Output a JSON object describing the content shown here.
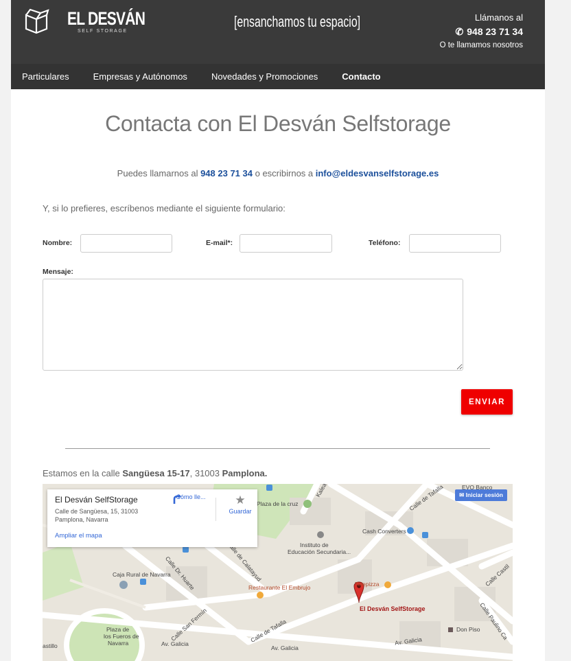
{
  "header": {
    "brand": "EL DESVÁN",
    "brand_sub": "SELF STORAGE",
    "slogan": "[ensanchamos tu espacio]",
    "call_label": "Llámanos al",
    "phone": "948 23 71 34",
    "callback": "O te llamamos nosotros"
  },
  "nav": {
    "items": [
      "Particulares",
      "Empresas y Autónomos",
      "Novedades y Promociones",
      "Contacto"
    ]
  },
  "main": {
    "title": "Contacta con El Desván Selfstorage",
    "contact_pre": "Puedes llamarnos al ",
    "contact_phone": "948 23 71 34",
    "contact_mid": " o escribirnos a ",
    "contact_email": "info@eldesvanselfstorage.es",
    "intro": "Y, si lo prefieres, escríbenos mediante el siguiente formulario:"
  },
  "form": {
    "name_label": "Nombre:",
    "email_label": "E-mail*:",
    "phone_label": "Teléfono:",
    "message_label": "Mensaje:",
    "submit": "ENVIAR"
  },
  "location": {
    "pre": "Estamos en la calle ",
    "street": "Sangüesa 15-17",
    "mid": ", 31003 ",
    "city": "Pamplona."
  },
  "map": {
    "card_title": "El Desván SelfStorage",
    "card_address_1": "Calle de Sangüesa, 15, 31003",
    "card_address_2": "Pamplona, Navarra",
    "card_enlarge": "Ampliar el mapa",
    "card_directions": "Cómo lle...",
    "card_save": "Guardar",
    "signin": "Iniciar sesión",
    "labels": {
      "plaza_cruz": "Plaza de la cruz",
      "kalea": "Kalea",
      "cash": "Cash Converters",
      "evo": "EVO Banco",
      "instituto_1": "Instituto de",
      "instituto_2": "Educación Secundaria...",
      "caja": "Caja Rural de Navarra",
      "huarte": "Calle Dr. Huarte",
      "calatayud": "Calle de Calatayud",
      "embrujo": "Restaurante El Embrujo",
      "telepizza": "Telepizza",
      "marker": "El Desván SelfStorage",
      "sanfermin": "Calle San Fermín",
      "tafalla_1": "Calle de Tafalla",
      "tafalla_2": "Calle de Tafalla",
      "plaza_fueros_1": "Plaza de",
      "plaza_fueros_2": "los Fueros de",
      "plaza_fueros_3": "Navarra",
      "galicia_1": "Av. Galicia",
      "galicia_2": "Av. Galicia",
      "galicia_3": "Av. Galicia",
      "castillo": "astillo",
      "donpiso": "Don Piso",
      "paulino": "Calle Paulino Ca",
      "castil": "Calle Castil"
    }
  }
}
